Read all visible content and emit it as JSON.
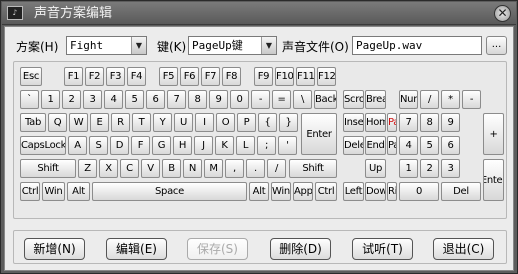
{
  "window": {
    "title": "声音方案编辑",
    "app_icon": "sound-app-icon",
    "close_glyph": "✕"
  },
  "scheme": {
    "label": "方案(H)",
    "value": "Fight"
  },
  "keyfield": {
    "label": "键(K)",
    "value": "PageUp键"
  },
  "soundfile": {
    "label": "声音文件(O)",
    "value": "PageUp.wav",
    "browse_label": "..."
  },
  "keyboard": {
    "selected_key": "PageUp",
    "keys": [
      {
        "id": "esc",
        "label": "Esc"
      },
      {
        "id": "f1",
        "label": "F1"
      },
      {
        "id": "f2",
        "label": "F2"
      },
      {
        "id": "f3",
        "label": "F3"
      },
      {
        "id": "f4",
        "label": "F4"
      },
      {
        "id": "f5",
        "label": "F5"
      },
      {
        "id": "f6",
        "label": "F6"
      },
      {
        "id": "f7",
        "label": "F7"
      },
      {
        "id": "f8",
        "label": "F8"
      },
      {
        "id": "f9",
        "label": "F9"
      },
      {
        "id": "f10",
        "label": "F10"
      },
      {
        "id": "f11",
        "label": "F11"
      },
      {
        "id": "f12",
        "label": "F12"
      },
      {
        "id": "backtick",
        "label": "`"
      },
      {
        "id": "d1",
        "label": "1"
      },
      {
        "id": "d2",
        "label": "2"
      },
      {
        "id": "d3",
        "label": "3"
      },
      {
        "id": "d4",
        "label": "4"
      },
      {
        "id": "d5",
        "label": "5"
      },
      {
        "id": "d6",
        "label": "6"
      },
      {
        "id": "d7",
        "label": "7"
      },
      {
        "id": "d8",
        "label": "8"
      },
      {
        "id": "d9",
        "label": "9"
      },
      {
        "id": "d0",
        "label": "0"
      },
      {
        "id": "minus",
        "label": "-"
      },
      {
        "id": "equals",
        "label": "="
      },
      {
        "id": "backslash",
        "label": "\\"
      },
      {
        "id": "backspace",
        "label": "Back"
      },
      {
        "id": "scroll",
        "label": "Scroll"
      },
      {
        "id": "break",
        "label": "Break"
      },
      {
        "id": "numlock",
        "label": "Num Lock"
      },
      {
        "id": "np_div",
        "label": "/"
      },
      {
        "id": "np_mul",
        "label": "*"
      },
      {
        "id": "np_sub",
        "label": "-"
      },
      {
        "id": "tab",
        "label": "Tab"
      },
      {
        "id": "q",
        "label": "Q"
      },
      {
        "id": "w",
        "label": "W"
      },
      {
        "id": "e",
        "label": "E"
      },
      {
        "id": "r",
        "label": "R"
      },
      {
        "id": "t",
        "label": "T"
      },
      {
        "id": "y",
        "label": "Y"
      },
      {
        "id": "u",
        "label": "U"
      },
      {
        "id": "i",
        "label": "I"
      },
      {
        "id": "o",
        "label": "O"
      },
      {
        "id": "p",
        "label": "P"
      },
      {
        "id": "lbracket",
        "label": "{"
      },
      {
        "id": "rbracket",
        "label": "}"
      },
      {
        "id": "enter",
        "label": "Enter"
      },
      {
        "id": "insert",
        "label": "Insert"
      },
      {
        "id": "home",
        "label": "Home"
      },
      {
        "id": "pageup",
        "label": "Page Up"
      },
      {
        "id": "np7",
        "label": "7"
      },
      {
        "id": "np8",
        "label": "8"
      },
      {
        "id": "np9",
        "label": "9"
      },
      {
        "id": "np_add",
        "label": "+"
      },
      {
        "id": "capslock",
        "label": "CapsLock"
      },
      {
        "id": "a",
        "label": "A"
      },
      {
        "id": "s",
        "label": "S"
      },
      {
        "id": "d",
        "label": "D"
      },
      {
        "id": "f",
        "label": "F"
      },
      {
        "id": "g",
        "label": "G"
      },
      {
        "id": "h",
        "label": "H"
      },
      {
        "id": "j",
        "label": "J"
      },
      {
        "id": "k",
        "label": "K"
      },
      {
        "id": "l",
        "label": "L"
      },
      {
        "id": "semicolon",
        "label": ";"
      },
      {
        "id": "quote",
        "label": "'"
      },
      {
        "id": "delete",
        "label": "Delete"
      },
      {
        "id": "end",
        "label": "End"
      },
      {
        "id": "pagedown",
        "label": "Page Down"
      },
      {
        "id": "np4",
        "label": "4"
      },
      {
        "id": "np5",
        "label": "5"
      },
      {
        "id": "np6",
        "label": "6"
      },
      {
        "id": "lshift",
        "label": "Shift"
      },
      {
        "id": "z",
        "label": "Z"
      },
      {
        "id": "x",
        "label": "X"
      },
      {
        "id": "c",
        "label": "C"
      },
      {
        "id": "v",
        "label": "V"
      },
      {
        "id": "b",
        "label": "B"
      },
      {
        "id": "n",
        "label": "N"
      },
      {
        "id": "m",
        "label": "M"
      },
      {
        "id": "comma",
        "label": ","
      },
      {
        "id": "period",
        "label": "."
      },
      {
        "id": "slash",
        "label": "/"
      },
      {
        "id": "rshift",
        "label": "Shift"
      },
      {
        "id": "up",
        "label": "Up"
      },
      {
        "id": "np1",
        "label": "1"
      },
      {
        "id": "np2",
        "label": "2"
      },
      {
        "id": "np3",
        "label": "3"
      },
      {
        "id": "np_enter",
        "label": "Enter"
      },
      {
        "id": "lctrl",
        "label": "Ctrl"
      },
      {
        "id": "lwin",
        "label": "Win"
      },
      {
        "id": "lalt",
        "label": "Alt"
      },
      {
        "id": "space",
        "label": "Space"
      },
      {
        "id": "ralt",
        "label": "Alt"
      },
      {
        "id": "rwin",
        "label": "Win"
      },
      {
        "id": "app",
        "label": "App"
      },
      {
        "id": "rctrl",
        "label": "Ctrl"
      },
      {
        "id": "left",
        "label": "Left"
      },
      {
        "id": "down",
        "label": "Down"
      },
      {
        "id": "right",
        "label": "Right"
      },
      {
        "id": "np0",
        "label": "0"
      },
      {
        "id": "np_del",
        "label": "Del"
      }
    ]
  },
  "buttons": {
    "new": "新增(N)",
    "edit": "编辑(E)",
    "save": "保存(S)",
    "delete": "删除(D)",
    "listen": "试听(T)",
    "exit": "退出(C)"
  }
}
